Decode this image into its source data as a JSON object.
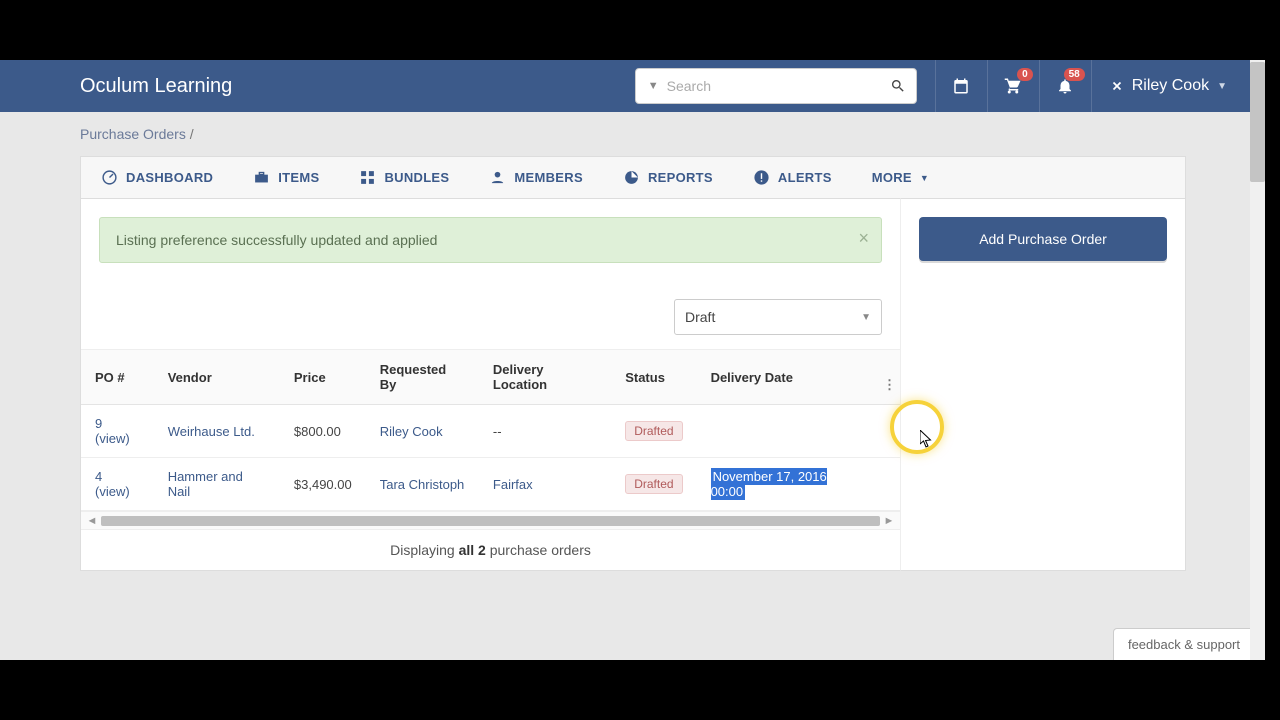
{
  "header": {
    "brand": "Oculum Learning",
    "search_placeholder": "Search",
    "cart_badge": "0",
    "bell_badge": "58",
    "user_name": "Riley Cook"
  },
  "breadcrumb": {
    "item": "Purchase Orders",
    "sep": " /"
  },
  "tabs": {
    "dashboard": "DASHBOARD",
    "items": "ITEMS",
    "bundles": "BUNDLES",
    "members": "MEMBERS",
    "reports": "REPORTS",
    "alerts": "ALERTS",
    "more": "MORE"
  },
  "alert": {
    "text": "Listing preference successfully updated and applied"
  },
  "filter": {
    "status_selected": "Draft"
  },
  "table": {
    "headers": {
      "po": "PO #",
      "vendor": "Vendor",
      "price": "Price",
      "requested_by": "Requested By",
      "location": "Delivery Location",
      "status": "Status",
      "delivery_date": "Delivery Date"
    },
    "rows": [
      {
        "po_num": "9",
        "po_view": " (view)",
        "vendor": "Weirhause Ltd.",
        "price": "$800.00",
        "requested_by": "Riley Cook",
        "location": "--",
        "status": "Drafted",
        "delivery_date": ""
      },
      {
        "po_num": "4",
        "po_view": " (view)",
        "vendor": "Hammer and Nail",
        "price": "$3,490.00",
        "requested_by": "Tara Christoph",
        "location": "Fairfax",
        "status": "Drafted",
        "delivery_date": "November 17, 2016 00:00"
      }
    ]
  },
  "pager": {
    "prefix": "Displaying ",
    "bold": "all 2",
    "suffix": " purchase orders"
  },
  "sidebar": {
    "add_button": "Add Purchase Order"
  },
  "feedback": {
    "label": "feedback & support"
  }
}
